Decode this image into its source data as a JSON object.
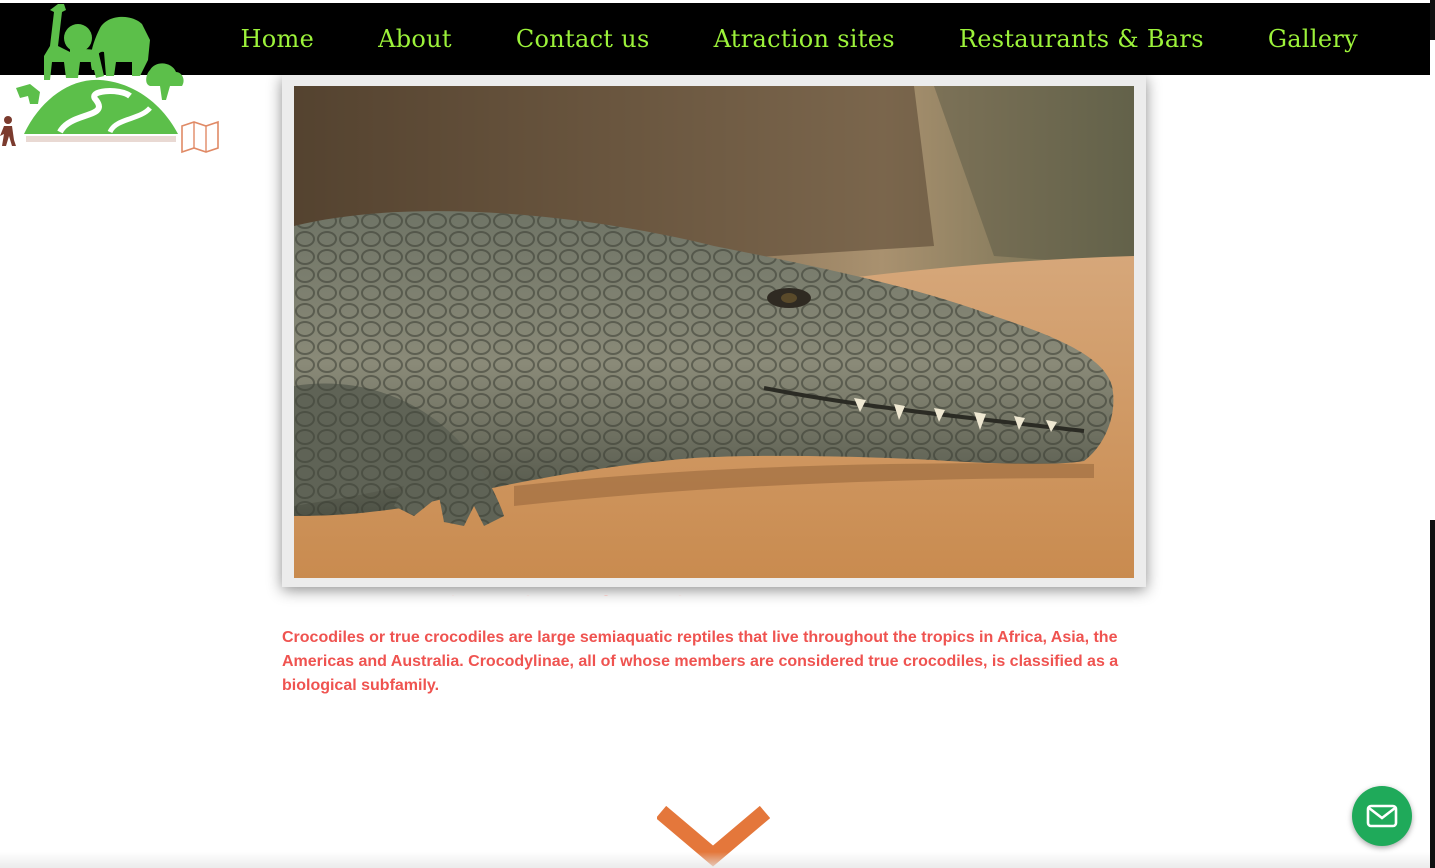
{
  "nav": {
    "items": [
      {
        "label": "Home"
      },
      {
        "label": "About"
      },
      {
        "label": "Contact us"
      },
      {
        "label": "Atraction sites"
      },
      {
        "label": "Restaurants & Bars"
      },
      {
        "label": "Gallery"
      }
    ]
  },
  "logo": {
    "icon": "safari-animals-logo"
  },
  "main": {
    "photo": {
      "subject": "crocodile-photo"
    },
    "description": "Crocodiles or true crocodiles are large semiaquatic reptiles that live throughout the tropics in Africa, Asia, the Americas and Australia. Crocodylinae, all of whose members are considered true crocodiles, is classified as a biological subfamily."
  },
  "scroll_down": {
    "icon": "chevron-down-icon"
  },
  "mail": {
    "icon": "mail-icon"
  },
  "colors": {
    "nav_background": "#000000",
    "nav_text": "#9cf23a",
    "logo_green": "#5cbf4a",
    "description_text": "#ef5350",
    "chevron": "#e4773b",
    "mail_button": "#1faa5a"
  }
}
